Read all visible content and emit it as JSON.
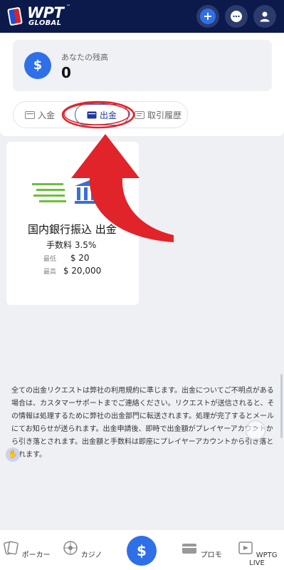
{
  "brand": {
    "name": "WPT",
    "tm": "™",
    "sub": "GLOBAL"
  },
  "balance": {
    "label": "あなたの残高",
    "value": "0",
    "icon": "dollar-icon"
  },
  "tabs": [
    {
      "label": "入金",
      "icon": "wallet-icon"
    },
    {
      "label": "出金",
      "icon": "withdraw-icon",
      "active": true
    },
    {
      "label": "取引履歴",
      "icon": "history-icon"
    }
  ],
  "method": {
    "title": "国内銀行振込 出金",
    "fee": "手数料 3.5%",
    "min_label": "最低",
    "min_value": "$ 20",
    "max_label": "最高",
    "max_value": "$ 20,000"
  },
  "notice": "全ての出金リクエストは弊社の利用規約に準じます。出金についてご不明点がある場合は、カスタマーサポートまでご連絡ください。リクエストが送信されると、その情報は処理するために弊社の出金部門に転送されます。処理が完了するとメールにてお知らせが送られます。出金申請後、即時で出金額がプレイヤーアカウントから引き落とされます。出金額と手数料は即座にプレイヤーアカウントから引き落とされます。",
  "nav": {
    "poker": "ポーカー",
    "casino": "カジノ",
    "center": "$",
    "promo": "プロモ",
    "live": "WPTG LIVE"
  },
  "colors": {
    "header": "#0b1a4a",
    "accent": "#2f6fe8",
    "highlight": "#e0242a"
  }
}
